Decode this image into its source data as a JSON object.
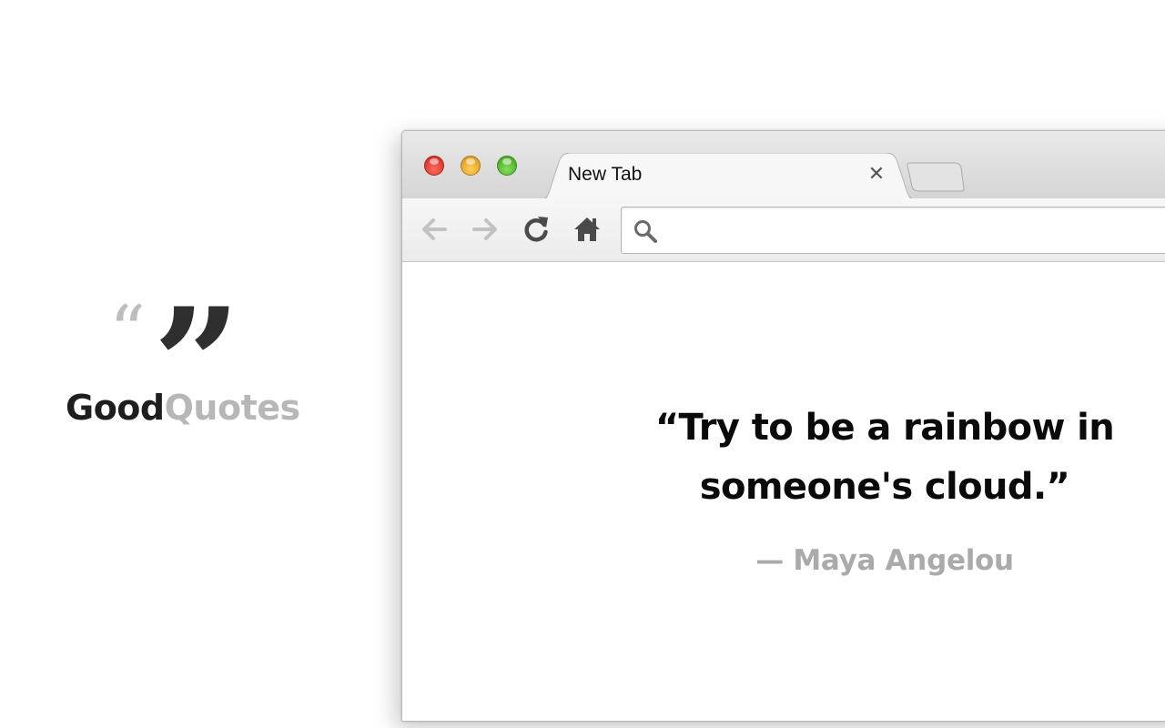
{
  "logo": {
    "open_quote": "“",
    "close_quote": "”",
    "word_primary": "Good",
    "word_secondary": "Quotes",
    "colors": {
      "primary": "#1e1e1e",
      "secondary": "#b7b7b7"
    }
  },
  "browser": {
    "traffic_lights": [
      {
        "name": "close",
        "color": "#e0443a"
      },
      {
        "name": "minimize",
        "color": "#f0a92c"
      },
      {
        "name": "maximize",
        "color": "#5cc03a"
      }
    ],
    "tab": {
      "title": "New Tab",
      "close_glyph": "✕"
    },
    "toolbar": {
      "icons": [
        "back-arrow-icon",
        "forward-arrow-icon",
        "reload-icon",
        "home-icon"
      ],
      "back_enabled": false,
      "forward_enabled": false
    },
    "omnibox": {
      "value": "",
      "icon": "search-icon"
    }
  },
  "page": {
    "quote": "“Try to be a rainbow in someone's cloud.”",
    "author": "— Maya Angelou"
  }
}
